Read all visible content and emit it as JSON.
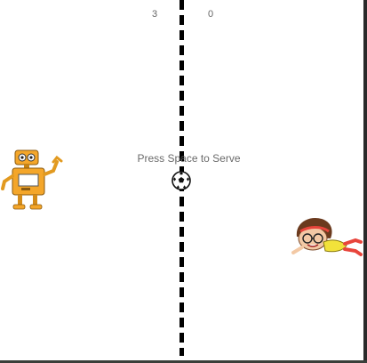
{
  "score": {
    "left": "3",
    "right": "0"
  },
  "prompt": "Press Space to Serve",
  "sprites": {
    "left_player": "robot-sprite",
    "right_player": "flying-kid-sprite",
    "ball": "soccer-ball-icon"
  },
  "colors": {
    "background": "#ffffff",
    "center_line": "#000000",
    "robot": "#f4a62a",
    "kid_shirt": "#f2e23a",
    "kid_hair": "#6b3a1e"
  }
}
